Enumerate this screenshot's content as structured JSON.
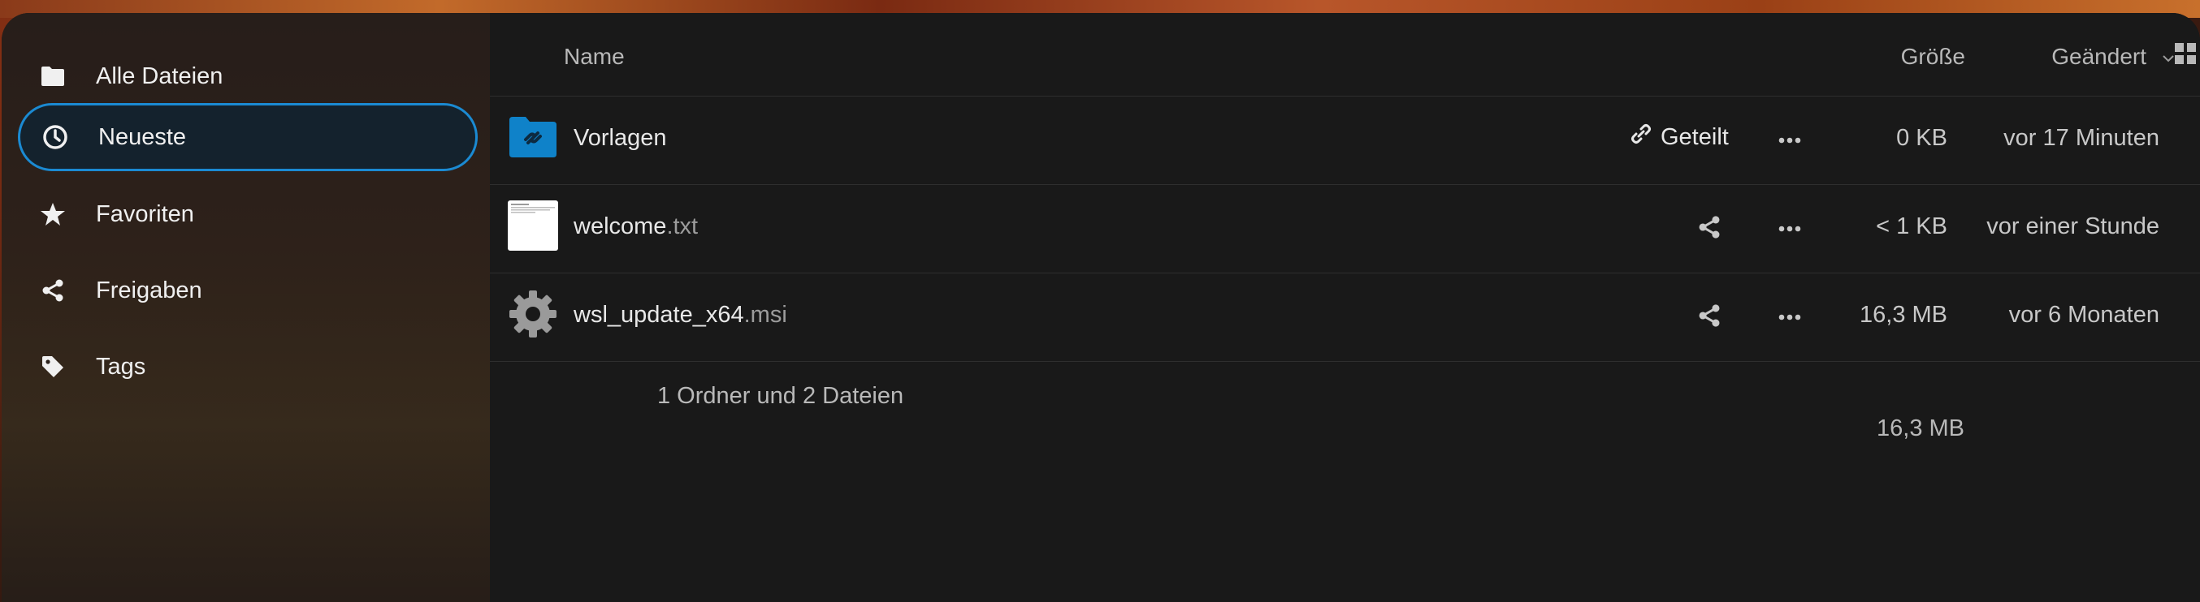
{
  "sidebar": {
    "items": [
      {
        "label": "Alle Dateien",
        "icon": "folder-icon",
        "active": false
      },
      {
        "label": "Neueste",
        "icon": "clock-icon",
        "active": true
      },
      {
        "label": "Favoriten",
        "icon": "star-icon",
        "active": false
      },
      {
        "label": "Freigaben",
        "icon": "share-icon",
        "active": false
      },
      {
        "label": "Tags",
        "icon": "tag-icon",
        "active": false
      }
    ]
  },
  "header": {
    "name": "Name",
    "size": "Größe",
    "modified": "Geändert",
    "view_toggle_icon": "grid-view-icon"
  },
  "files": [
    {
      "name": "Vorlagen",
      "ext": "",
      "share_label": "Geteilt",
      "size": "0 KB",
      "modified": "vor 17 Minuten",
      "icon": "shared-folder-icon"
    },
    {
      "name": "welcome",
      "ext": ".txt",
      "size": "< 1 KB",
      "modified": "vor einer Stunde",
      "icon": "text-file-icon"
    },
    {
      "name": "wsl_update_x64",
      "ext": ".msi",
      "size": "16,3 MB",
      "modified": "vor 6 Monaten",
      "icon": "gear-icon"
    }
  ],
  "summary": {
    "label": "1 Ordner und 2 Dateien",
    "total_size": "16,3 MB"
  },
  "colors": {
    "accent": "#1b8ad2",
    "folder_blue": "#0f82c9",
    "background": "#191919"
  }
}
